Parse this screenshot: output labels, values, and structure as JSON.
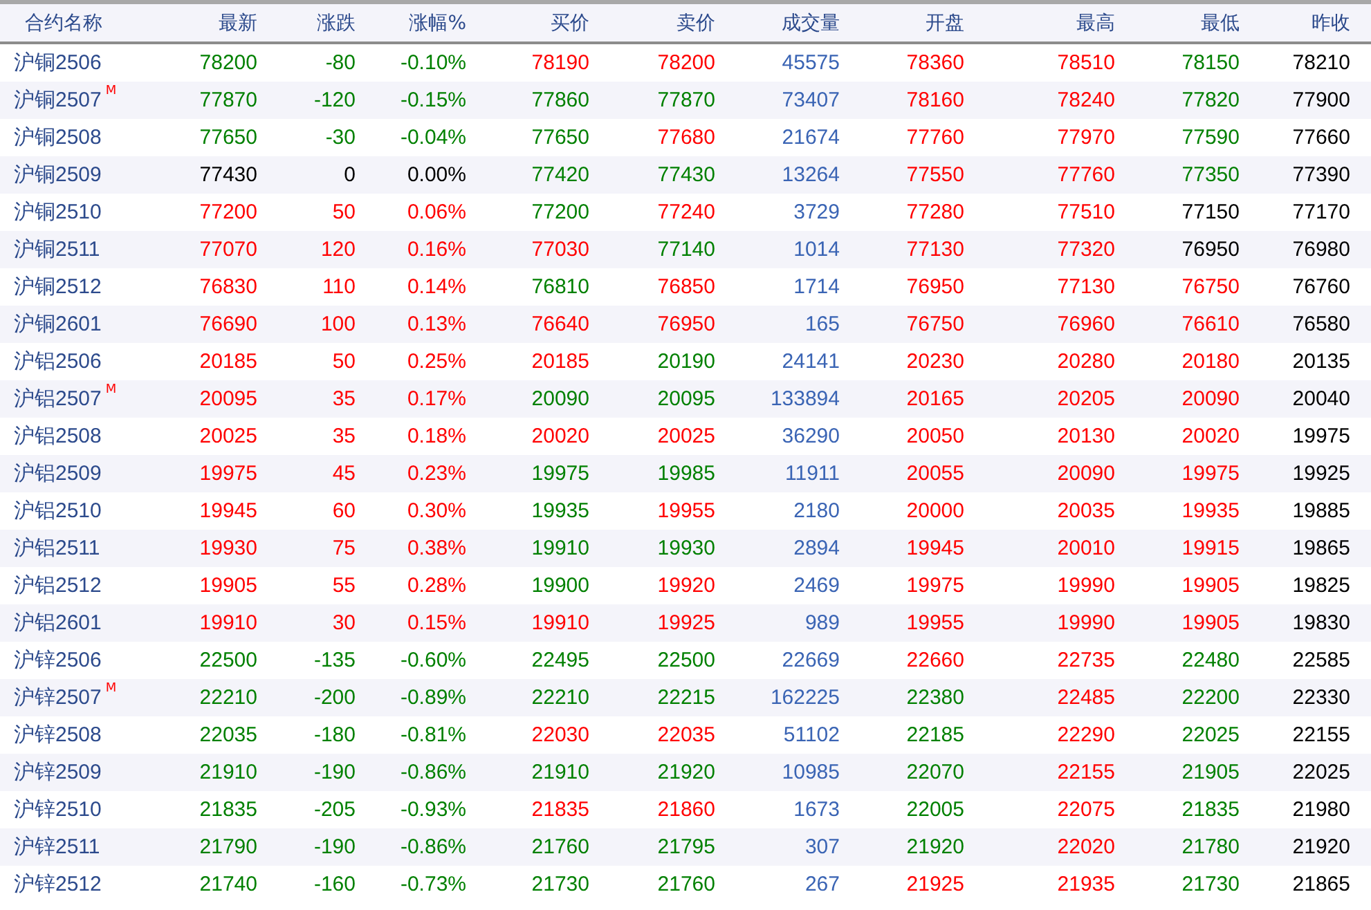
{
  "table": {
    "columns": [
      "合约名称",
      "最新",
      "涨跌",
      "涨幅%",
      "买价",
      "卖价",
      "成交量",
      "开盘",
      "最高",
      "最低",
      "昨收"
    ],
    "rows": [
      {
        "badge": null,
        "cells": [
          {
            "text": "沪铜2506"
          },
          {
            "text": "78200",
            "color": "#008000"
          },
          {
            "text": "-80",
            "color": "#008000"
          },
          {
            "text": "-0.10%",
            "color": "#008000"
          },
          {
            "text": "78190",
            "color": "#ff0000"
          },
          {
            "text": "78200",
            "color": "#ff0000"
          },
          {
            "text": "45575",
            "color": "#3a64b4"
          },
          {
            "text": "78360",
            "color": "#ff0000"
          },
          {
            "text": "78510",
            "color": "#ff0000"
          },
          {
            "text": "78150",
            "color": "#008000"
          },
          {
            "text": "78210",
            "color": "#000000"
          }
        ]
      },
      {
        "badge": "M",
        "cells": [
          {
            "text": "沪铜2507"
          },
          {
            "text": "77870",
            "color": "#008000"
          },
          {
            "text": "-120",
            "color": "#008000"
          },
          {
            "text": "-0.15%",
            "color": "#008000"
          },
          {
            "text": "77860",
            "color": "#008000"
          },
          {
            "text": "77870",
            "color": "#008000"
          },
          {
            "text": "73407",
            "color": "#3a64b4"
          },
          {
            "text": "78160",
            "color": "#ff0000"
          },
          {
            "text": "78240",
            "color": "#ff0000"
          },
          {
            "text": "77820",
            "color": "#008000"
          },
          {
            "text": "77900",
            "color": "#000000"
          }
        ]
      },
      {
        "badge": null,
        "cells": [
          {
            "text": "沪铜2508"
          },
          {
            "text": "77650",
            "color": "#008000"
          },
          {
            "text": "-30",
            "color": "#008000"
          },
          {
            "text": "-0.04%",
            "color": "#008000"
          },
          {
            "text": "77650",
            "color": "#008000"
          },
          {
            "text": "77680",
            "color": "#ff0000"
          },
          {
            "text": "21674",
            "color": "#3a64b4"
          },
          {
            "text": "77760",
            "color": "#ff0000"
          },
          {
            "text": "77970",
            "color": "#ff0000"
          },
          {
            "text": "77590",
            "color": "#008000"
          },
          {
            "text": "77660",
            "color": "#000000"
          }
        ]
      },
      {
        "badge": null,
        "cells": [
          {
            "text": "沪铜2509"
          },
          {
            "text": "77430",
            "color": "#000000"
          },
          {
            "text": "0",
            "color": "#000000"
          },
          {
            "text": "0.00%",
            "color": "#000000"
          },
          {
            "text": "77420",
            "color": "#008000"
          },
          {
            "text": "77430",
            "color": "#008000"
          },
          {
            "text": "13264",
            "color": "#3a64b4"
          },
          {
            "text": "77550",
            "color": "#ff0000"
          },
          {
            "text": "77760",
            "color": "#ff0000"
          },
          {
            "text": "77350",
            "color": "#008000"
          },
          {
            "text": "77390",
            "color": "#000000"
          }
        ]
      },
      {
        "badge": null,
        "cells": [
          {
            "text": "沪铜2510"
          },
          {
            "text": "77200",
            "color": "#ff0000"
          },
          {
            "text": "50",
            "color": "#ff0000"
          },
          {
            "text": "0.06%",
            "color": "#ff0000"
          },
          {
            "text": "77200",
            "color": "#008000"
          },
          {
            "text": "77240",
            "color": "#ff0000"
          },
          {
            "text": "3729",
            "color": "#3a64b4"
          },
          {
            "text": "77280",
            "color": "#ff0000"
          },
          {
            "text": "77510",
            "color": "#ff0000"
          },
          {
            "text": "77150",
            "color": "#000000"
          },
          {
            "text": "77170",
            "color": "#000000"
          }
        ]
      },
      {
        "badge": null,
        "cells": [
          {
            "text": "沪铜2511"
          },
          {
            "text": "77070",
            "color": "#ff0000"
          },
          {
            "text": "120",
            "color": "#ff0000"
          },
          {
            "text": "0.16%",
            "color": "#ff0000"
          },
          {
            "text": "77030",
            "color": "#ff0000"
          },
          {
            "text": "77140",
            "color": "#008000"
          },
          {
            "text": "1014",
            "color": "#3a64b4"
          },
          {
            "text": "77130",
            "color": "#ff0000"
          },
          {
            "text": "77320",
            "color": "#ff0000"
          },
          {
            "text": "76950",
            "color": "#000000"
          },
          {
            "text": "76980",
            "color": "#000000"
          }
        ]
      },
      {
        "badge": null,
        "cells": [
          {
            "text": "沪铜2512"
          },
          {
            "text": "76830",
            "color": "#ff0000"
          },
          {
            "text": "110",
            "color": "#ff0000"
          },
          {
            "text": "0.14%",
            "color": "#ff0000"
          },
          {
            "text": "76810",
            "color": "#008000"
          },
          {
            "text": "76850",
            "color": "#ff0000"
          },
          {
            "text": "1714",
            "color": "#3a64b4"
          },
          {
            "text": "76950",
            "color": "#ff0000"
          },
          {
            "text": "77130",
            "color": "#ff0000"
          },
          {
            "text": "76750",
            "color": "#ff0000"
          },
          {
            "text": "76760",
            "color": "#000000"
          }
        ]
      },
      {
        "badge": null,
        "cells": [
          {
            "text": "沪铜2601"
          },
          {
            "text": "76690",
            "color": "#ff0000"
          },
          {
            "text": "100",
            "color": "#ff0000"
          },
          {
            "text": "0.13%",
            "color": "#ff0000"
          },
          {
            "text": "76640",
            "color": "#ff0000"
          },
          {
            "text": "76950",
            "color": "#ff0000"
          },
          {
            "text": "165",
            "color": "#3a64b4"
          },
          {
            "text": "76750",
            "color": "#ff0000"
          },
          {
            "text": "76960",
            "color": "#ff0000"
          },
          {
            "text": "76610",
            "color": "#ff0000"
          },
          {
            "text": "76580",
            "color": "#000000"
          }
        ]
      },
      {
        "badge": null,
        "cells": [
          {
            "text": "沪铝2506"
          },
          {
            "text": "20185",
            "color": "#ff0000"
          },
          {
            "text": "50",
            "color": "#ff0000"
          },
          {
            "text": "0.25%",
            "color": "#ff0000"
          },
          {
            "text": "20185",
            "color": "#ff0000"
          },
          {
            "text": "20190",
            "color": "#008000"
          },
          {
            "text": "24141",
            "color": "#3a64b4"
          },
          {
            "text": "20230",
            "color": "#ff0000"
          },
          {
            "text": "20280",
            "color": "#ff0000"
          },
          {
            "text": "20180",
            "color": "#ff0000"
          },
          {
            "text": "20135",
            "color": "#000000"
          }
        ]
      },
      {
        "badge": "M",
        "cells": [
          {
            "text": "沪铝2507"
          },
          {
            "text": "20095",
            "color": "#ff0000"
          },
          {
            "text": "35",
            "color": "#ff0000"
          },
          {
            "text": "0.17%",
            "color": "#ff0000"
          },
          {
            "text": "20090",
            "color": "#008000"
          },
          {
            "text": "20095",
            "color": "#008000"
          },
          {
            "text": "133894",
            "color": "#3a64b4"
          },
          {
            "text": "20165",
            "color": "#ff0000"
          },
          {
            "text": "20205",
            "color": "#ff0000"
          },
          {
            "text": "20090",
            "color": "#ff0000"
          },
          {
            "text": "20040",
            "color": "#000000"
          }
        ]
      },
      {
        "badge": null,
        "cells": [
          {
            "text": "沪铝2508"
          },
          {
            "text": "20025",
            "color": "#ff0000"
          },
          {
            "text": "35",
            "color": "#ff0000"
          },
          {
            "text": "0.18%",
            "color": "#ff0000"
          },
          {
            "text": "20020",
            "color": "#ff0000"
          },
          {
            "text": "20025",
            "color": "#ff0000"
          },
          {
            "text": "36290",
            "color": "#3a64b4"
          },
          {
            "text": "20050",
            "color": "#ff0000"
          },
          {
            "text": "20130",
            "color": "#ff0000"
          },
          {
            "text": "20020",
            "color": "#ff0000"
          },
          {
            "text": "19975",
            "color": "#000000"
          }
        ]
      },
      {
        "badge": null,
        "cells": [
          {
            "text": "沪铝2509"
          },
          {
            "text": "19975",
            "color": "#ff0000"
          },
          {
            "text": "45",
            "color": "#ff0000"
          },
          {
            "text": "0.23%",
            "color": "#ff0000"
          },
          {
            "text": "19975",
            "color": "#008000"
          },
          {
            "text": "19985",
            "color": "#008000"
          },
          {
            "text": "11911",
            "color": "#3a64b4"
          },
          {
            "text": "20055",
            "color": "#ff0000"
          },
          {
            "text": "20090",
            "color": "#ff0000"
          },
          {
            "text": "19975",
            "color": "#ff0000"
          },
          {
            "text": "19925",
            "color": "#000000"
          }
        ]
      },
      {
        "badge": null,
        "cells": [
          {
            "text": "沪铝2510"
          },
          {
            "text": "19945",
            "color": "#ff0000"
          },
          {
            "text": "60",
            "color": "#ff0000"
          },
          {
            "text": "0.30%",
            "color": "#ff0000"
          },
          {
            "text": "19935",
            "color": "#008000"
          },
          {
            "text": "19955",
            "color": "#ff0000"
          },
          {
            "text": "2180",
            "color": "#3a64b4"
          },
          {
            "text": "20000",
            "color": "#ff0000"
          },
          {
            "text": "20035",
            "color": "#ff0000"
          },
          {
            "text": "19935",
            "color": "#ff0000"
          },
          {
            "text": "19885",
            "color": "#000000"
          }
        ]
      },
      {
        "badge": null,
        "cells": [
          {
            "text": "沪铝2511"
          },
          {
            "text": "19930",
            "color": "#ff0000"
          },
          {
            "text": "75",
            "color": "#ff0000"
          },
          {
            "text": "0.38%",
            "color": "#ff0000"
          },
          {
            "text": "19910",
            "color": "#008000"
          },
          {
            "text": "19930",
            "color": "#008000"
          },
          {
            "text": "2894",
            "color": "#3a64b4"
          },
          {
            "text": "19945",
            "color": "#ff0000"
          },
          {
            "text": "20010",
            "color": "#ff0000"
          },
          {
            "text": "19915",
            "color": "#ff0000"
          },
          {
            "text": "19865",
            "color": "#000000"
          }
        ]
      },
      {
        "badge": null,
        "cells": [
          {
            "text": "沪铝2512"
          },
          {
            "text": "19905",
            "color": "#ff0000"
          },
          {
            "text": "55",
            "color": "#ff0000"
          },
          {
            "text": "0.28%",
            "color": "#ff0000"
          },
          {
            "text": "19900",
            "color": "#008000"
          },
          {
            "text": "19920",
            "color": "#ff0000"
          },
          {
            "text": "2469",
            "color": "#3a64b4"
          },
          {
            "text": "19975",
            "color": "#ff0000"
          },
          {
            "text": "19990",
            "color": "#ff0000"
          },
          {
            "text": "19905",
            "color": "#ff0000"
          },
          {
            "text": "19825",
            "color": "#000000"
          }
        ]
      },
      {
        "badge": null,
        "cells": [
          {
            "text": "沪铝2601"
          },
          {
            "text": "19910",
            "color": "#ff0000"
          },
          {
            "text": "30",
            "color": "#ff0000"
          },
          {
            "text": "0.15%",
            "color": "#ff0000"
          },
          {
            "text": "19910",
            "color": "#ff0000"
          },
          {
            "text": "19925",
            "color": "#ff0000"
          },
          {
            "text": "989",
            "color": "#3a64b4"
          },
          {
            "text": "19955",
            "color": "#ff0000"
          },
          {
            "text": "19990",
            "color": "#ff0000"
          },
          {
            "text": "19905",
            "color": "#ff0000"
          },
          {
            "text": "19830",
            "color": "#000000"
          }
        ]
      },
      {
        "badge": null,
        "cells": [
          {
            "text": "沪锌2506"
          },
          {
            "text": "22500",
            "color": "#008000"
          },
          {
            "text": "-135",
            "color": "#008000"
          },
          {
            "text": "-0.60%",
            "color": "#008000"
          },
          {
            "text": "22495",
            "color": "#008000"
          },
          {
            "text": "22500",
            "color": "#008000"
          },
          {
            "text": "22669",
            "color": "#3a64b4"
          },
          {
            "text": "22660",
            "color": "#ff0000"
          },
          {
            "text": "22735",
            "color": "#ff0000"
          },
          {
            "text": "22480",
            "color": "#008000"
          },
          {
            "text": "22585",
            "color": "#000000"
          }
        ]
      },
      {
        "badge": "M",
        "cells": [
          {
            "text": "沪锌2507"
          },
          {
            "text": "22210",
            "color": "#008000"
          },
          {
            "text": "-200",
            "color": "#008000"
          },
          {
            "text": "-0.89%",
            "color": "#008000"
          },
          {
            "text": "22210",
            "color": "#008000"
          },
          {
            "text": "22215",
            "color": "#008000"
          },
          {
            "text": "162225",
            "color": "#3a64b4"
          },
          {
            "text": "22380",
            "color": "#008000"
          },
          {
            "text": "22485",
            "color": "#ff0000"
          },
          {
            "text": "22200",
            "color": "#008000"
          },
          {
            "text": "22330",
            "color": "#000000"
          }
        ]
      },
      {
        "badge": null,
        "cells": [
          {
            "text": "沪锌2508"
          },
          {
            "text": "22035",
            "color": "#008000"
          },
          {
            "text": "-180",
            "color": "#008000"
          },
          {
            "text": "-0.81%",
            "color": "#008000"
          },
          {
            "text": "22030",
            "color": "#ff0000"
          },
          {
            "text": "22035",
            "color": "#ff0000"
          },
          {
            "text": "51102",
            "color": "#3a64b4"
          },
          {
            "text": "22185",
            "color": "#008000"
          },
          {
            "text": "22290",
            "color": "#ff0000"
          },
          {
            "text": "22025",
            "color": "#008000"
          },
          {
            "text": "22155",
            "color": "#000000"
          }
        ]
      },
      {
        "badge": null,
        "cells": [
          {
            "text": "沪锌2509"
          },
          {
            "text": "21910",
            "color": "#008000"
          },
          {
            "text": "-190",
            "color": "#008000"
          },
          {
            "text": "-0.86%",
            "color": "#008000"
          },
          {
            "text": "21910",
            "color": "#008000"
          },
          {
            "text": "21920",
            "color": "#008000"
          },
          {
            "text": "10985",
            "color": "#3a64b4"
          },
          {
            "text": "22070",
            "color": "#008000"
          },
          {
            "text": "22155",
            "color": "#ff0000"
          },
          {
            "text": "21905",
            "color": "#008000"
          },
          {
            "text": "22025",
            "color": "#000000"
          }
        ]
      },
      {
        "badge": null,
        "cells": [
          {
            "text": "沪锌2510"
          },
          {
            "text": "21835",
            "color": "#008000"
          },
          {
            "text": "-205",
            "color": "#008000"
          },
          {
            "text": "-0.93%",
            "color": "#008000"
          },
          {
            "text": "21835",
            "color": "#ff0000"
          },
          {
            "text": "21860",
            "color": "#ff0000"
          },
          {
            "text": "1673",
            "color": "#3a64b4"
          },
          {
            "text": "22005",
            "color": "#008000"
          },
          {
            "text": "22075",
            "color": "#ff0000"
          },
          {
            "text": "21835",
            "color": "#008000"
          },
          {
            "text": "21980",
            "color": "#000000"
          }
        ]
      },
      {
        "badge": null,
        "cells": [
          {
            "text": "沪锌2511"
          },
          {
            "text": "21790",
            "color": "#008000"
          },
          {
            "text": "-190",
            "color": "#008000"
          },
          {
            "text": "-0.86%",
            "color": "#008000"
          },
          {
            "text": "21760",
            "color": "#008000"
          },
          {
            "text": "21795",
            "color": "#008000"
          },
          {
            "text": "307",
            "color": "#3a64b4"
          },
          {
            "text": "21920",
            "color": "#008000"
          },
          {
            "text": "22020",
            "color": "#ff0000"
          },
          {
            "text": "21780",
            "color": "#008000"
          },
          {
            "text": "21920",
            "color": "#000000"
          }
        ]
      },
      {
        "badge": null,
        "cells": [
          {
            "text": "沪锌2512"
          },
          {
            "text": "21740",
            "color": "#008000"
          },
          {
            "text": "-160",
            "color": "#008000"
          },
          {
            "text": "-0.73%",
            "color": "#008000"
          },
          {
            "text": "21730",
            "color": "#008000"
          },
          {
            "text": "21760",
            "color": "#008000"
          },
          {
            "text": "267",
            "color": "#3a64b4"
          },
          {
            "text": "21925",
            "color": "#ff0000"
          },
          {
            "text": "21935",
            "color": "#ff0000"
          },
          {
            "text": "21730",
            "color": "#008000"
          },
          {
            "text": "21865",
            "color": "#000000"
          }
        ]
      }
    ]
  }
}
